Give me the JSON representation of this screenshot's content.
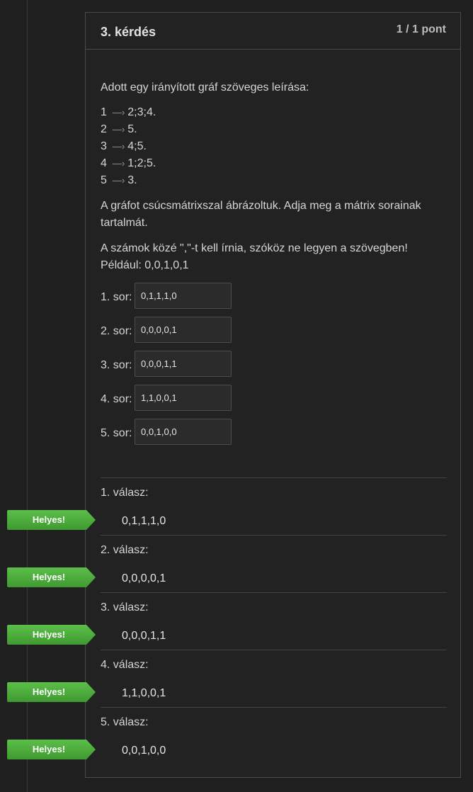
{
  "question": {
    "title": "3. kérdés",
    "points": "1 / 1 pont",
    "intro": "Adott egy irányított gráf szöveges leírása:",
    "edge_arrow": "—›",
    "edges": [
      {
        "node": "1",
        "targets": "2;3;4."
      },
      {
        "node": "2",
        "targets": "5."
      },
      {
        "node": "3",
        "targets": "4;5."
      },
      {
        "node": "4",
        "targets": "1;2;5."
      },
      {
        "node": "5",
        "targets": "3."
      }
    ],
    "task_line1": "A gráfot csúcsmátrixszal ábrázoltuk. Adja meg a mátrix sorainak",
    "task_line2": "tartalmát.",
    "rule_line1": "A számok közé \",\"-t kell írnia, szóköz ne legyen a szövegben!",
    "rule_line2": "Például: 0,0,1,0,1",
    "rows": [
      {
        "label": "1. sor:",
        "value": "0,1,1,1,0"
      },
      {
        "label": "2. sor:",
        "value": "0,0,0,0,1"
      },
      {
        "label": "3. sor:",
        "value": "0,0,0,1,1"
      },
      {
        "label": "4. sor:",
        "value": "1,1,0,0,1"
      },
      {
        "label": "5. sor:",
        "value": "0,0,1,0,0"
      }
    ]
  },
  "answers": [
    {
      "label": "1. válasz:",
      "status": "Helyes!",
      "value": "0,1,1,1,0"
    },
    {
      "label": "2. válasz:",
      "status": "Helyes!",
      "value": "0,0,0,0,1"
    },
    {
      "label": "3. válasz:",
      "status": "Helyes!",
      "value": "0,0,0,1,1"
    },
    {
      "label": "4. válasz:",
      "status": "Helyes!",
      "value": "1,1,0,0,1"
    },
    {
      "label": "5. válasz:",
      "status": "Helyes!",
      "value": "0,0,1,0,0"
    }
  ],
  "colors": {
    "badge_green": "#4aa83a",
    "background": "#1f1f1f",
    "card": "#222223"
  }
}
